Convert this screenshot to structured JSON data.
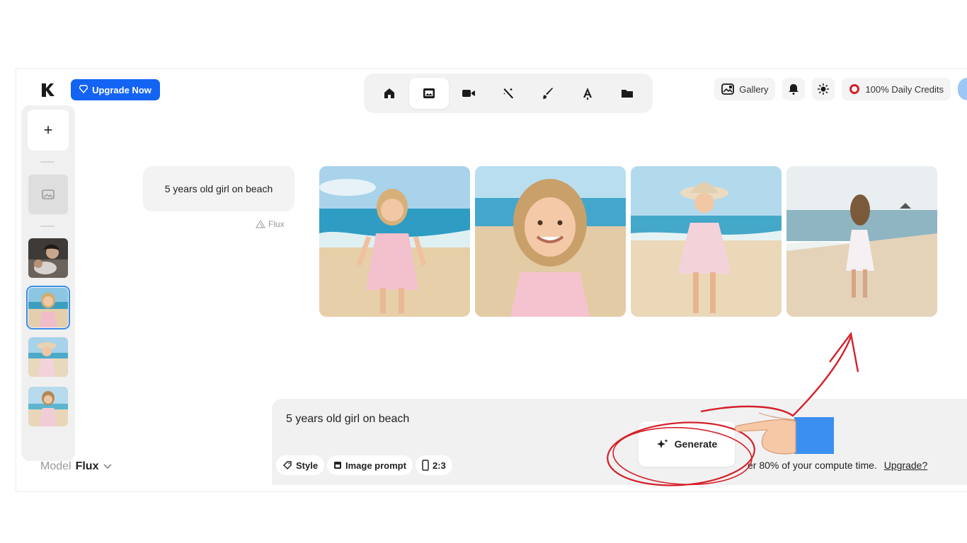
{
  "header": {
    "upgrade_label": "Upgrade Now",
    "nav_items": [
      "home-icon",
      "image-icon",
      "video-icon",
      "magic-wand-icon",
      "brush-icon",
      "text-icon",
      "folder-icon"
    ],
    "active_nav": "image-icon",
    "gallery_label": "Gallery",
    "credits_label": "100% Daily Credits"
  },
  "sidebar": {
    "new_label": "+"
  },
  "conversation": {
    "prompt": "5 years old girl on beach",
    "model_tag": "Flux"
  },
  "composer": {
    "text": "5 years old girl on beach",
    "chips": [
      {
        "label": "Style",
        "icon": "style-icon"
      },
      {
        "label": "Image prompt",
        "icon": "image-prompt-icon"
      },
      {
        "label": "2:3",
        "icon": "aspect-ratio-icon"
      }
    ],
    "generate_label": "Generate",
    "notice_text": "er 80% of your compute time.",
    "notice_link": "Upgrade?"
  },
  "model_selector": {
    "label": "Model",
    "value": "Flux"
  },
  "colors": {
    "accent": "#1464f4",
    "annotation": "#d4202a",
    "selected_outline": "#3b8ee6"
  }
}
